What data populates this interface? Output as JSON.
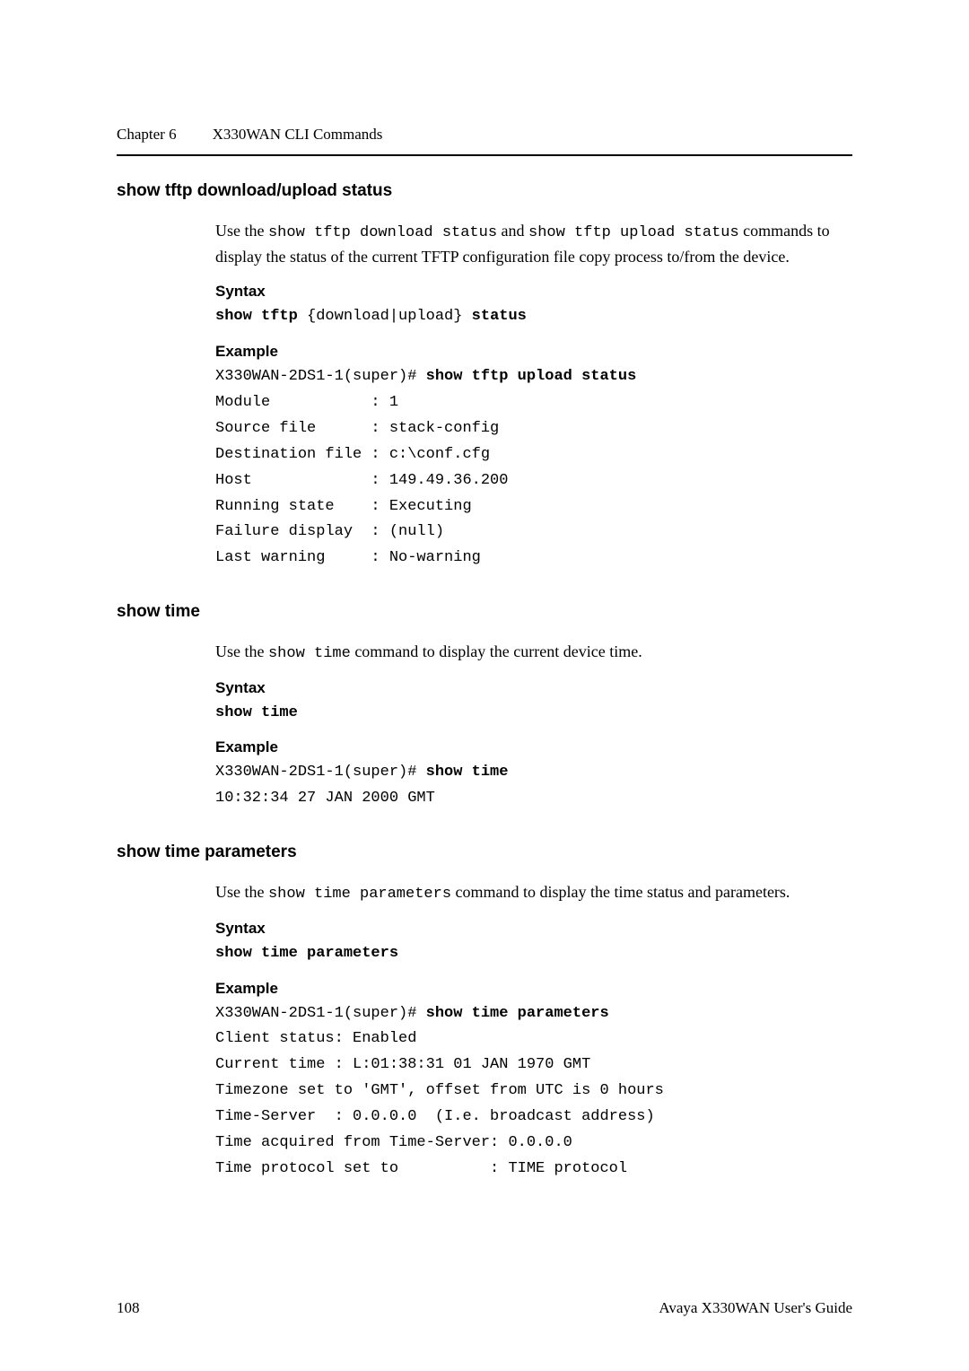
{
  "header": {
    "chapter": "Chapter 6",
    "title": "X330WAN CLI Commands"
  },
  "section1": {
    "title": "show tftp download/upload status",
    "desc_pre": "Use the ",
    "cmd1": "show tftp download status",
    "desc_mid": " and ",
    "cmd2": "show tftp upload status",
    "desc_post": " commands to display the status of the current TFTP configuration file copy process to/from the device.",
    "syntax_heading": "Syntax",
    "syntax_pre": "show tftp",
    "syntax_mid": " {download|upload} ",
    "syntax_post": "status",
    "example_heading": "Example",
    "example_prompt": "X330WAN-2DS1-1(super)# ",
    "example_cmd": "show tftp upload status",
    "example_out": "Module           : 1\nSource file      : stack-config\nDestination file : c:\\conf.cfg\nHost             : 149.49.36.200\nRunning state    : Executing\nFailure display  : (null)\nLast warning     : No-warning"
  },
  "section2": {
    "title": "show time",
    "desc_pre": "Use the ",
    "cmd": "show time",
    "desc_post": " command to display the current device time.",
    "syntax_heading": "Syntax",
    "syntax_code": "show time",
    "example_heading": "Example",
    "example_prompt": "X330WAN-2DS1-1(super)# ",
    "example_cmd": "show time",
    "example_out": "10:32:34 27 JAN 2000 GMT"
  },
  "section3": {
    "title": "show time parameters",
    "desc_pre": "Use the ",
    "cmd": "show time parameters",
    "desc_post": " command to display the time status and parameters.",
    "syntax_heading": "Syntax",
    "syntax_code": "show time parameters",
    "example_heading": "Example",
    "example_prompt": "X330WAN-2DS1-1(super)# ",
    "example_cmd": "show time parameters",
    "example_out": "Client status: Enabled\nCurrent time : L:01:38:31 01 JAN 1970 GMT\nTimezone set to 'GMT', offset from UTC is 0 hours\nTime-Server  : 0.0.0.0  (I.e. broadcast address)\nTime acquired from Time-Server: 0.0.0.0\nTime protocol set to          : TIME protocol"
  },
  "footer": {
    "page": "108",
    "title": "Avaya X330WAN User's Guide"
  }
}
